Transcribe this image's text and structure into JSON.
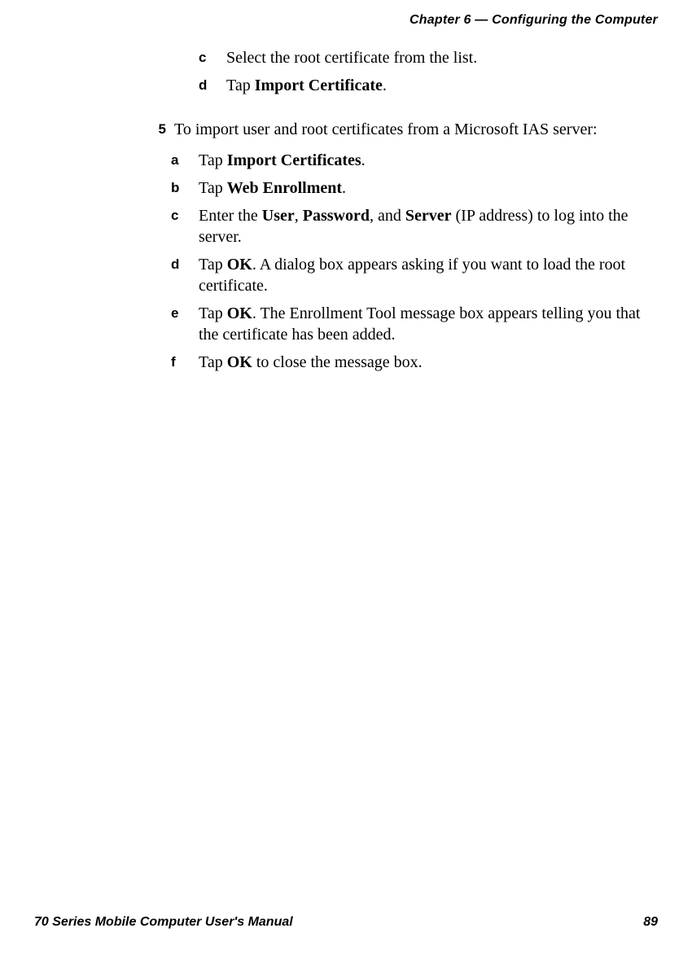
{
  "header": {
    "chapter_label": "Chapter 6 — Configuring the Computer"
  },
  "prev_sub": {
    "c_marker": "c",
    "c_text": "Select the root certificate from the list.",
    "d_marker": "d",
    "d_prefix": "Tap ",
    "d_bold": "Import Certificate",
    "d_suffix": "."
  },
  "step5": {
    "marker": "5",
    "text": "To import user and root certificates from a Microsoft IAS server:",
    "a_marker": "a",
    "a_prefix": "Tap ",
    "a_bold": "Import Certificates",
    "a_suffix": ".",
    "b_marker": "b",
    "b_prefix": "Tap ",
    "b_bold": "Web Enrollment",
    "b_suffix": ".",
    "c_marker": "c",
    "c_t1": "Enter the ",
    "c_b1": "User",
    "c_t2": ", ",
    "c_b2": "Password",
    "c_t3": ", and ",
    "c_b3": "Server",
    "c_t4": " (IP address) to log into the server.",
    "d_marker": "d",
    "d_t1": "Tap ",
    "d_b1": "OK",
    "d_t2": ". A dialog box appears asking if you want to load the root certificate.",
    "e_marker": "e",
    "e_t1": "Tap ",
    "e_b1": "OK",
    "e_t2": ". The Enrollment Tool message box appears telling you that the certificate has been added.",
    "f_marker": "f",
    "f_t1": "Tap ",
    "f_b1": "OK",
    "f_t2": " to close the message box."
  },
  "footer": {
    "manual_title": "70 Series Mobile Computer User's Manual",
    "page_number": "89"
  }
}
